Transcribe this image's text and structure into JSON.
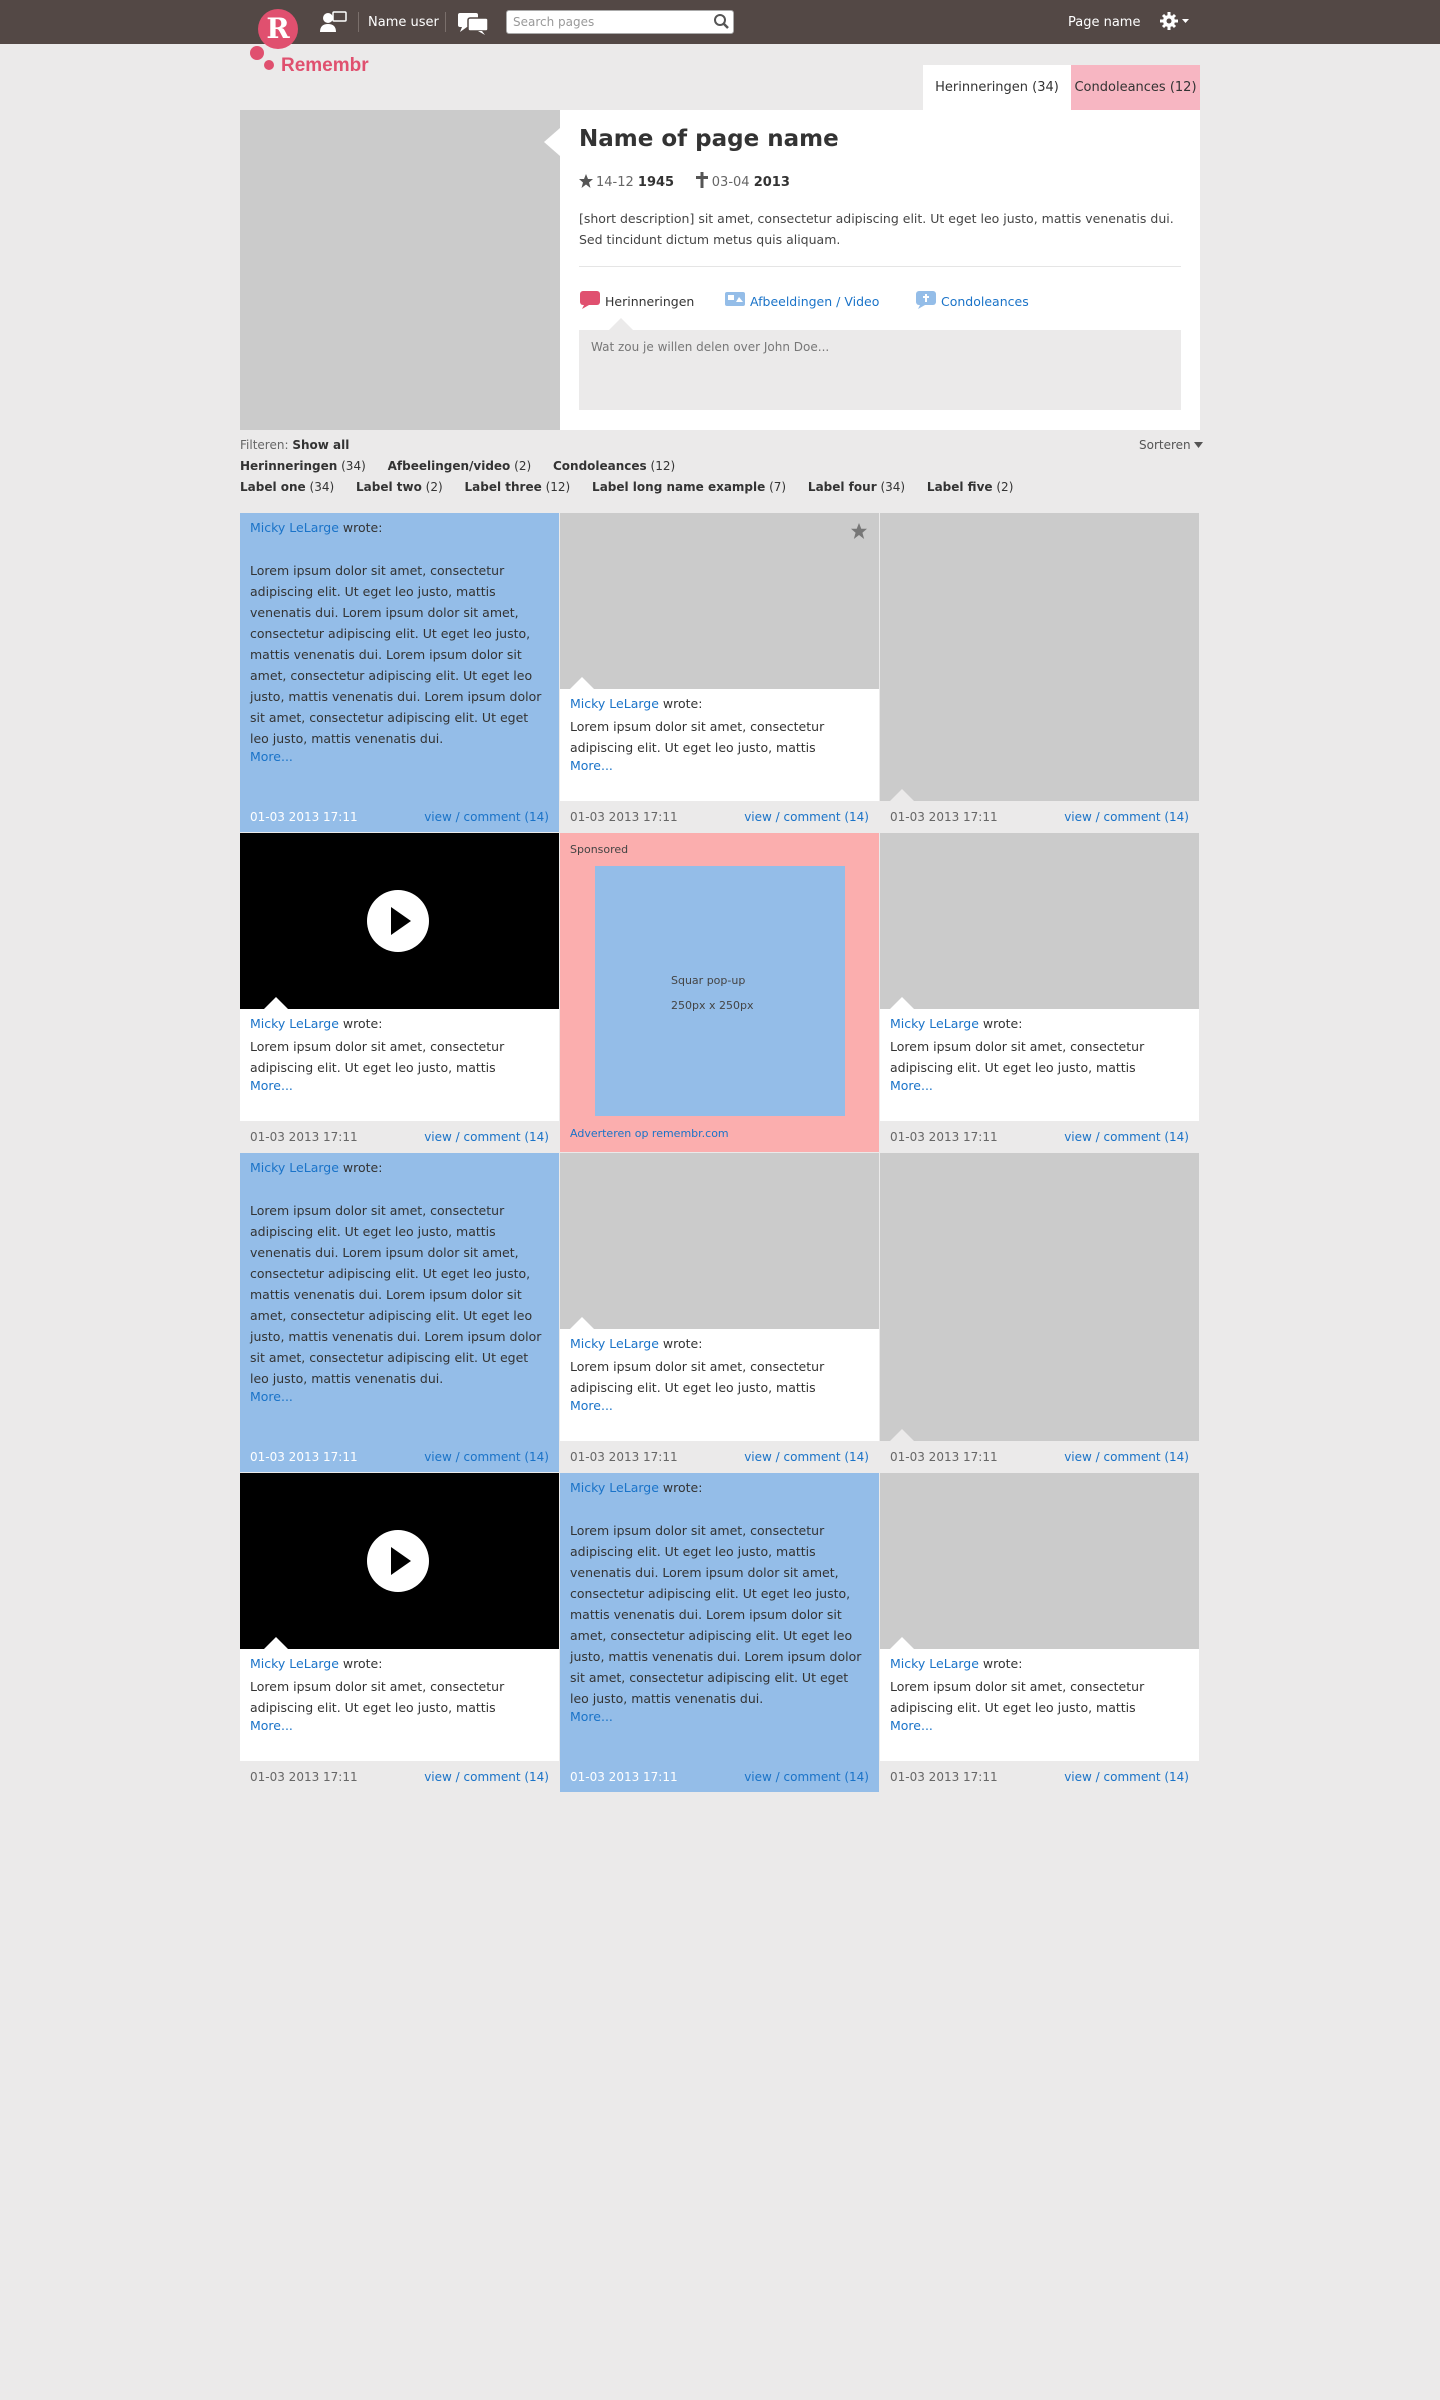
{
  "topbar": {
    "logo_letter": "R",
    "logo_text": "Remembr",
    "user_name": "Name user",
    "search_placeholder": "Search pages",
    "page_name": "Page name",
    "colors": {
      "bar": "#534845",
      "brand": "#e0506f"
    }
  },
  "tabs": [
    {
      "label": "Herinneringen (34)"
    },
    {
      "label": "Condoleances (12)"
    }
  ],
  "profile": {
    "title": "Name of page name",
    "birth_day": "14-12",
    "birth_year": "1945",
    "death_day": "03-04",
    "death_year": "2013",
    "description": "[short description] sit amet, consectetur adipiscing elit. Ut eget leo justo, mattis venenatis dui. Sed tincidunt dictum metus quis aliquam.",
    "post_tabs": [
      "Herinneringen",
      "Afbeeldingen / Video",
      "Condoleances"
    ],
    "share_placeholder": "Wat zou je willen delen over John Doe..."
  },
  "filters": {
    "filter_label": "Filteren:",
    "show_all": "Show all",
    "sort_label": "Sorteren",
    "types": [
      {
        "name": "Herinneringen",
        "count": "(34)"
      },
      {
        "name": "Afbeelingen/video",
        "count": "(2)"
      },
      {
        "name": "Condoleances",
        "count": "(12)"
      }
    ],
    "labels": [
      {
        "name": "Label one",
        "count": "(34)"
      },
      {
        "name": "Label two",
        "count": "(2)"
      },
      {
        "name": "Label three",
        "count": "(12)"
      },
      {
        "name": "Label long name example",
        "count": "(7)"
      },
      {
        "name": "Label four",
        "count": "(34)"
      },
      {
        "name": "Label five",
        "count": "(2)"
      }
    ]
  },
  "post": {
    "author": "Micky LeLarge",
    "wrote": "wrote:",
    "long_text": "Lorem ipsum dolor sit amet, consectetur adipiscing elit. Ut eget leo justo, mattis venenatis dui.  Lorem ipsum dolor sit amet, consectetur adipiscing elit. Ut eget leo justo, mattis venenatis dui. Lorem ipsum dolor sit amet, consectetur adipiscing elit. Ut eget leo justo, mattis venenatis dui. Lorem ipsum dolor sit amet, consectetur adipiscing elit. Ut eget leo justo, mattis venenatis dui.",
    "short_text": "Lorem ipsum dolor sit amet, consectetur adipiscing elit. Ut eget leo justo, mattis",
    "more": "More...",
    "date": "01-03 2013 17:11",
    "view": "view",
    "slash": "/",
    "comment": "comment (14)"
  },
  "ad": {
    "sponsored": "Sponsored",
    "line1": "Squar pop-up",
    "line2": "250px x 250px",
    "link": "Adverteren op remembr.com"
  }
}
